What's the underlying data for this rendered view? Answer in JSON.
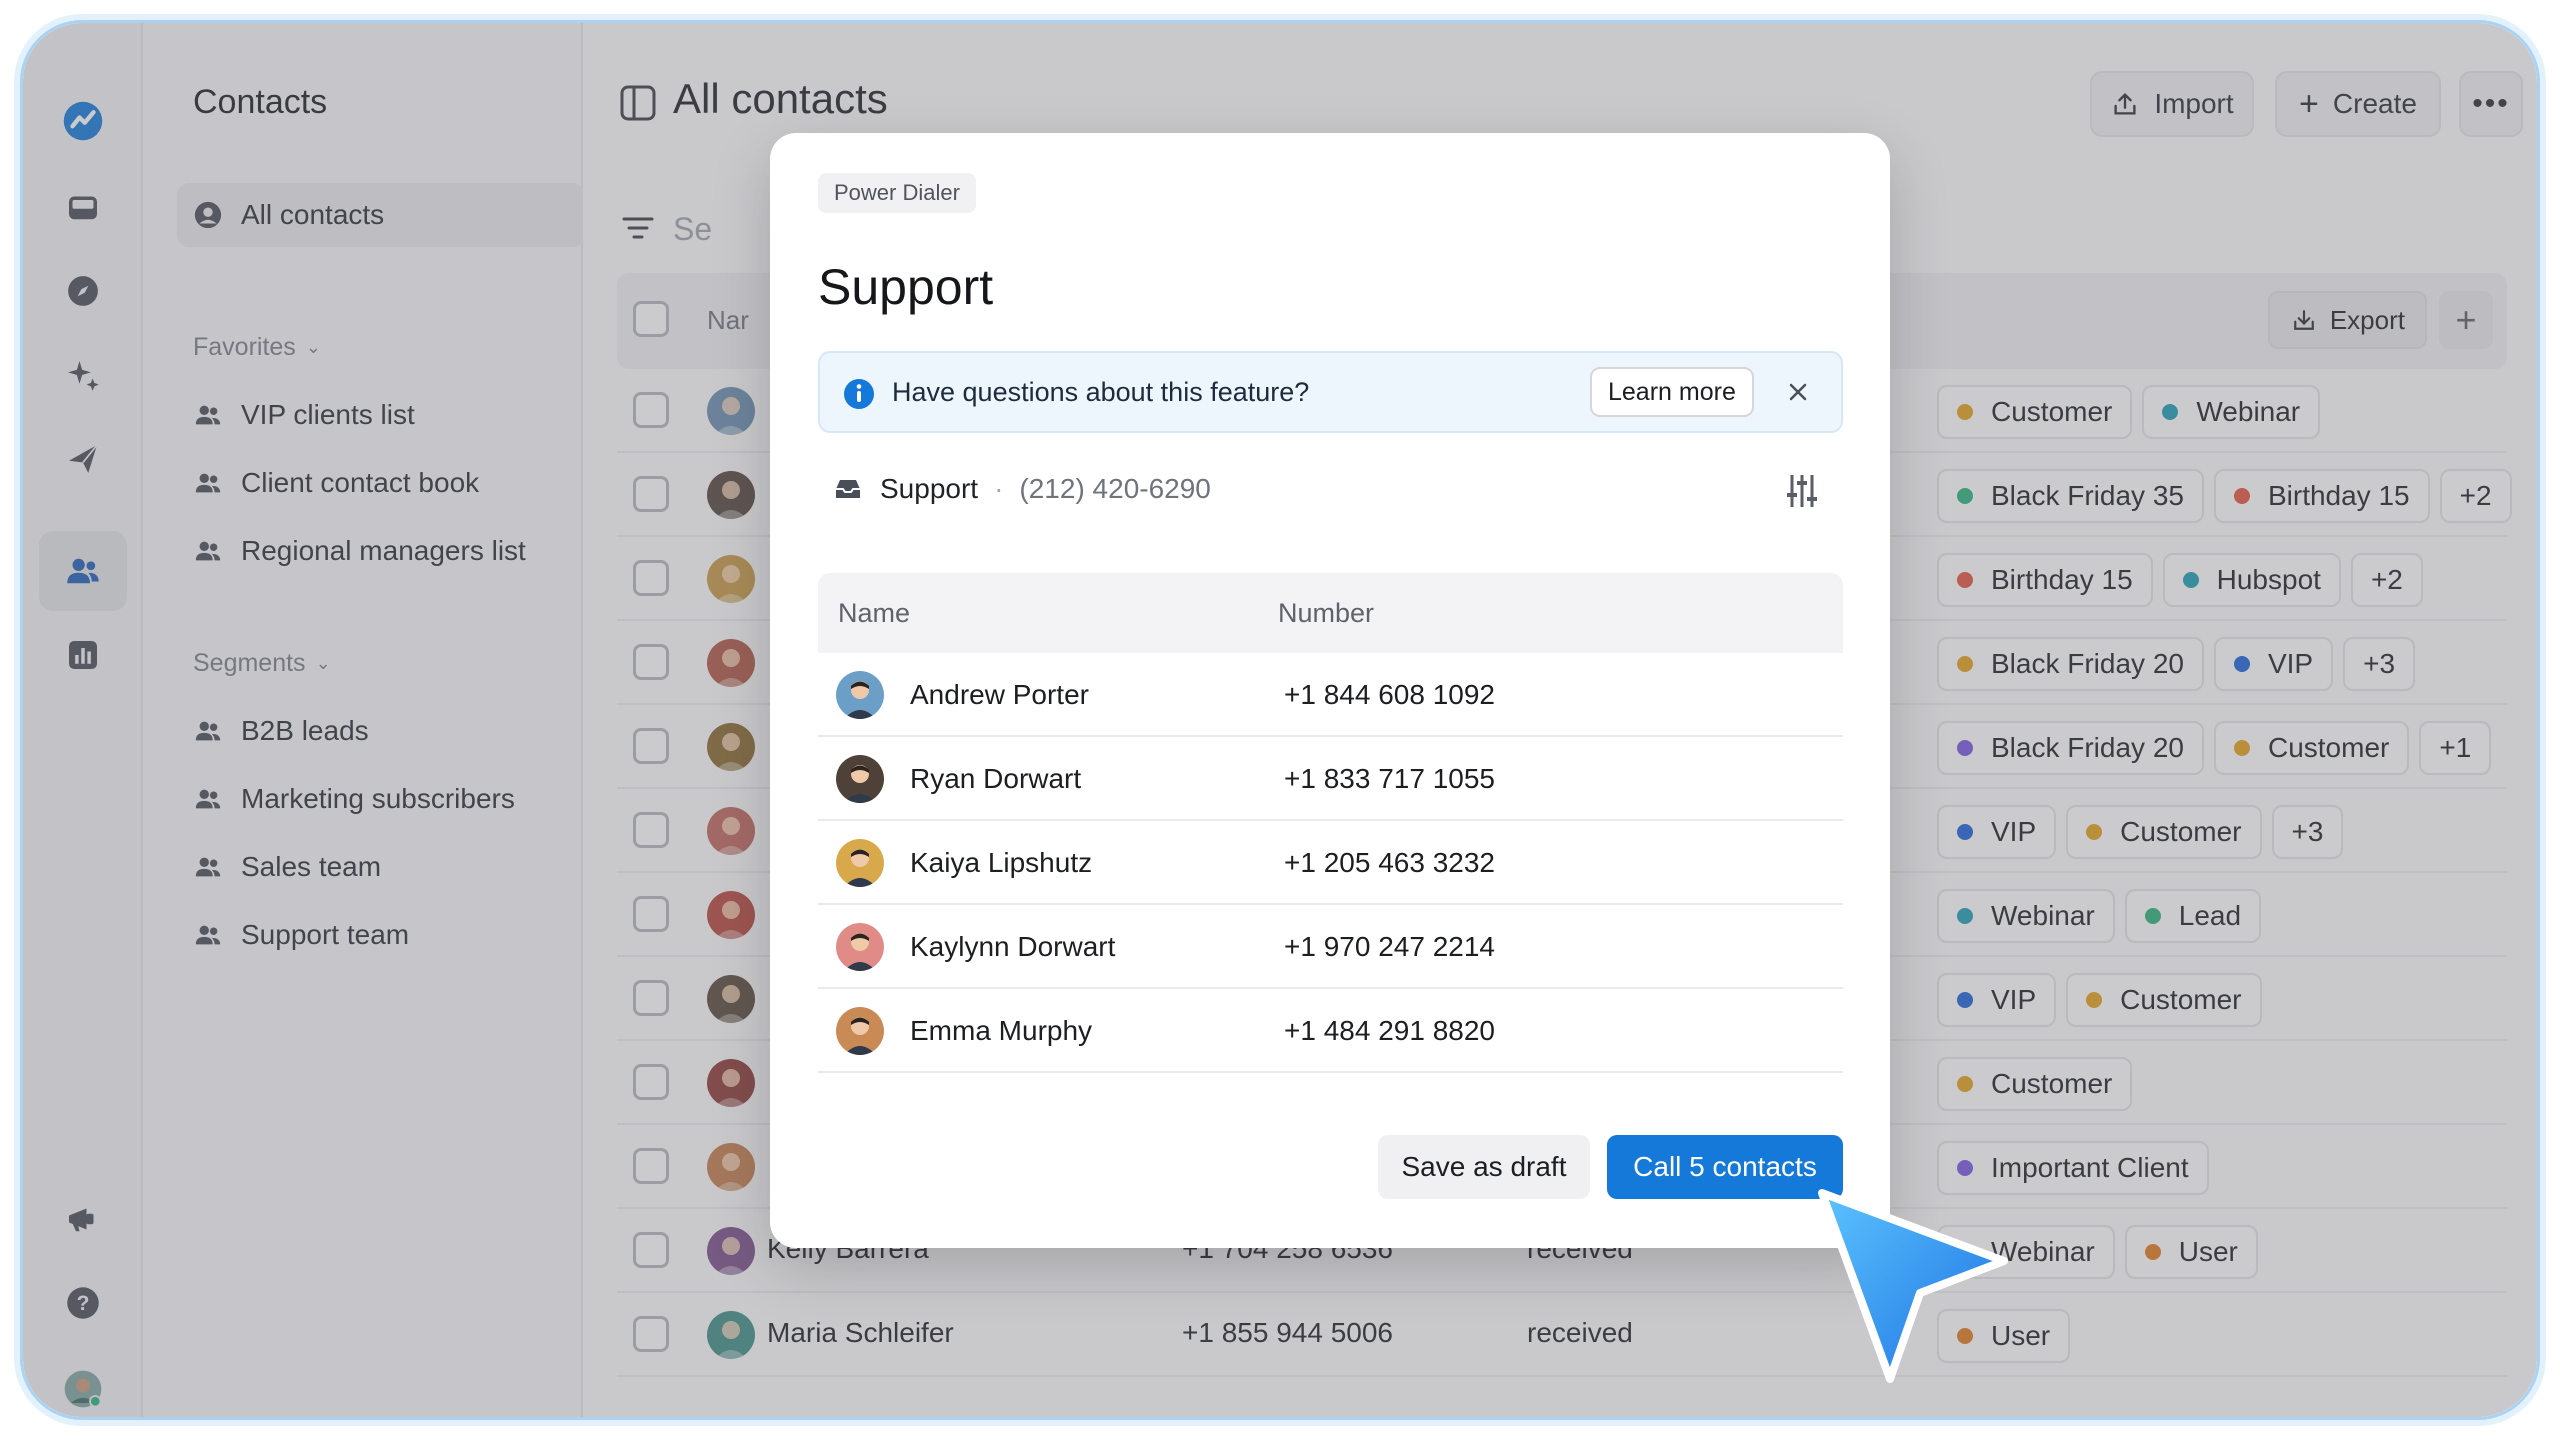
{
  "colors": {
    "accent": "#1479d8",
    "orange": "#e4a21a",
    "teal": "#1f9fb4",
    "green": "#2bb37a",
    "red": "#e5533d",
    "blue": "#1b63d8",
    "purple": "#7b57e0",
    "orange2": "#e07b1a"
  },
  "rail": {
    "icons": [
      "logo-icon",
      "inbox-icon",
      "compass-icon",
      "sparkles-icon",
      "send-icon",
      "contacts-icon",
      "chart-icon",
      "megaphone-icon",
      "help-icon",
      "user-avatar"
    ]
  },
  "sidebar": {
    "title": "Contacts",
    "all_contacts": "All contacts",
    "favorites_label": "Favorites",
    "favorites": [
      "VIP clients list",
      "Client contact book",
      "Regional managers list"
    ],
    "segments_label": "Segments",
    "segments": [
      "B2B leads",
      "Marketing subscribers",
      "Sales team",
      "Support team"
    ]
  },
  "main": {
    "title": "All contacts",
    "import_label": "Import",
    "create_label": "Create",
    "search_placeholder": "Se",
    "name_header": "Nar",
    "export_label": "Export",
    "rows": [
      {
        "name": "",
        "number": "",
        "status": "",
        "tags": [
          [
            "Customer",
            "orange"
          ],
          [
            "Webinar",
            "teal"
          ]
        ]
      },
      {
        "name": "",
        "number": "",
        "status": "",
        "tags": [
          [
            "Black Friday 35",
            "green"
          ],
          [
            "Birthday 15",
            "red"
          ],
          [
            "+2",
            ""
          ]
        ]
      },
      {
        "name": "",
        "number": "",
        "status": "",
        "tags": [
          [
            "Birthday 15",
            "red"
          ],
          [
            "Hubspot",
            "teal"
          ],
          [
            "+2",
            ""
          ]
        ]
      },
      {
        "name": "",
        "number": "",
        "status": "",
        "tags": [
          [
            "Black Friday 20",
            "orange"
          ],
          [
            "VIP",
            "blue"
          ],
          [
            "+3",
            ""
          ]
        ]
      },
      {
        "name": "",
        "number": "",
        "status": "",
        "tags": [
          [
            "Black Friday 20",
            "purple"
          ],
          [
            "Customer",
            "orange"
          ],
          [
            "+1",
            ""
          ]
        ]
      },
      {
        "name": "",
        "number": "",
        "status": "",
        "tags": [
          [
            "VIP",
            "blue"
          ],
          [
            "Customer",
            "orange"
          ],
          [
            "+3",
            ""
          ]
        ]
      },
      {
        "name": "",
        "number": "",
        "status": "",
        "tags": [
          [
            "Webinar",
            "teal"
          ],
          [
            "Lead",
            "green"
          ]
        ]
      },
      {
        "name": "",
        "number": "",
        "status": "",
        "tags": [
          [
            "VIP",
            "blue"
          ],
          [
            "Customer",
            "orange"
          ]
        ]
      },
      {
        "name": "",
        "number": "",
        "status": "",
        "tags": [
          [
            "Customer",
            "orange"
          ]
        ]
      },
      {
        "name": "",
        "number": "",
        "status": "",
        "tags": [
          [
            "Important Client",
            "purple"
          ]
        ]
      },
      {
        "name": "Kelly Barrera",
        "number": "+1 704 258 6536",
        "status": "received",
        "tags": [
          [
            "Webinar",
            "teal"
          ],
          [
            "User",
            "orange2"
          ]
        ]
      },
      {
        "name": "Maria Schleifer",
        "number": "+1 855 944 5006",
        "status": "received",
        "tags": [
          [
            "User",
            "orange2"
          ]
        ]
      }
    ]
  },
  "modal": {
    "breadcrumb": "Power Dialer",
    "title": "Support",
    "info_text": "Have questions about this feature?",
    "learn_more": "Learn more",
    "line_name": "Support",
    "line_sep": "·",
    "line_number": "(212) 420-6290",
    "col_name": "Name",
    "col_number": "Number",
    "contacts": [
      {
        "name": "Andrew Porter",
        "number": "+1 844 608 1092"
      },
      {
        "name": "Ryan Dorwart",
        "number": "+1 833 717 1055"
      },
      {
        "name": "Kaiya Lipshutz",
        "number": "+1 205 463 3232"
      },
      {
        "name": "Kaylynn Dorwart",
        "number": "+1 970 247 2214"
      },
      {
        "name": "Emma Murphy",
        "number": "+1 484 291 8820"
      }
    ],
    "save_draft": "Save as draft",
    "call_button": "Call 5 contacts"
  }
}
